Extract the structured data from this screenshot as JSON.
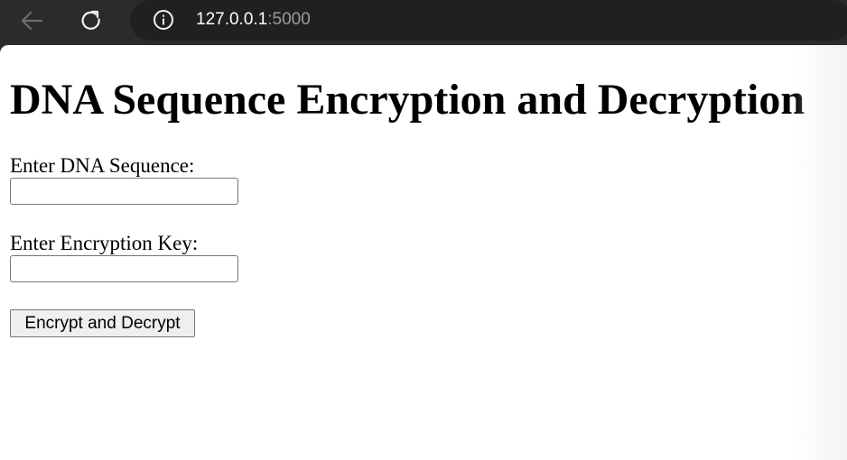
{
  "browser": {
    "url_host": "127.0.0.1",
    "url_port": ":5000",
    "icons": {
      "back": "back-arrow-icon",
      "reload": "reload-icon",
      "info": "info-icon"
    }
  },
  "page": {
    "title": "DNA Sequence Encryption and Decryption",
    "form": {
      "dna_label": "Enter DNA Sequence:",
      "dna_value": "",
      "key_label": "Enter Encryption Key:",
      "key_value": "",
      "submit_label": "Encrypt and Decrypt"
    }
  },
  "colors": {
    "chrome_bg": "#2b2b2b",
    "address_bg": "#202020",
    "page_bg": "#ffffff",
    "button_bg": "#efefef"
  }
}
